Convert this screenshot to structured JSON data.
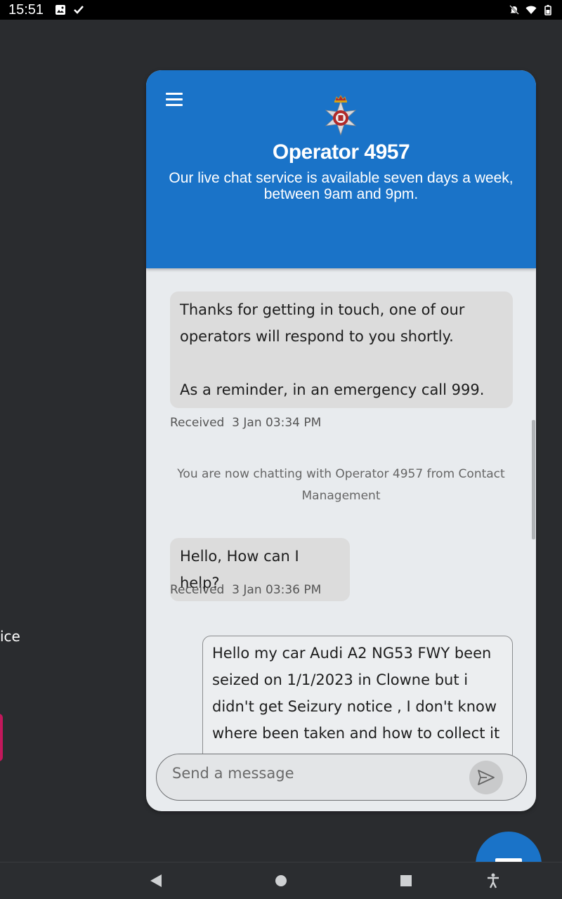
{
  "status_bar": {
    "time": "15:51",
    "left_icons": [
      "image-icon",
      "check-icon"
    ],
    "right_icons": [
      "dnd-off-icon",
      "wifi-icon",
      "battery-icon"
    ]
  },
  "background": {
    "partial_text": "ice"
  },
  "chat": {
    "header": {
      "title": "Operator 4957",
      "subtitle": "Our live chat service is available seven days a week, between 9am and 9pm."
    },
    "messages": [
      {
        "type": "received",
        "lines": [
          "Thanks for getting in touch, one of our",
          "operators will respond to you shortly.",
          "",
          "As a reminder, in an emergency call 999."
        ],
        "meta_label": "Received",
        "meta_time": "3 Jan 03:34 PM"
      },
      {
        "type": "system",
        "text": "You are now chatting with Operator 4957 from Contact Management"
      },
      {
        "type": "received",
        "lines": [
          "Hello, How can I help?"
        ],
        "meta_label": "Received",
        "meta_time": "3 Jan 03:36 PM"
      },
      {
        "type": "sent",
        "lines": [
          "Hello my car Audi A2 NG53 FWY been",
          "seized on 1/1/2023 in Clowne but i",
          "didn't get Seizury notice , I don't know",
          "where been taken and how to collect it"
        ]
      }
    ],
    "composer": {
      "placeholder": "Send a message",
      "value": ""
    }
  },
  "nav_bar": {
    "buttons": [
      "back-icon",
      "home-icon",
      "recents-icon",
      "accessibility-icon"
    ]
  },
  "colors": {
    "header_blue": "#1a73c8",
    "panel_bg": "#e8ebee",
    "screen_bg": "#2a2c2f"
  }
}
